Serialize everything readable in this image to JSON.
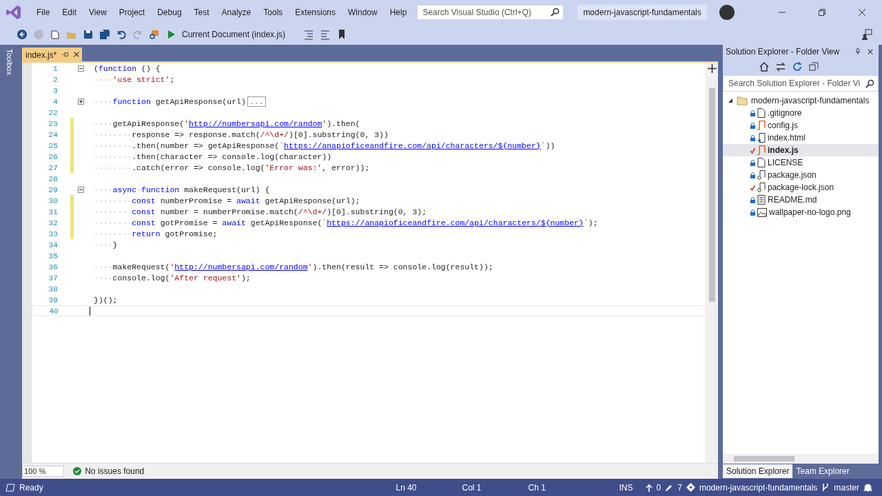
{
  "menu": [
    "File",
    "Edit",
    "View",
    "Project",
    "Debug",
    "Test",
    "Analyze",
    "Tools",
    "Extensions",
    "Window",
    "Help"
  ],
  "search": {
    "placeholder": "Search Visual Studio (Ctrl+Q)"
  },
  "solution_name": "modern-javascript-fundamentals",
  "toolbar": {
    "run_target": "Current Document (index.js)"
  },
  "toolbox": "Toolbox",
  "editor": {
    "tab": {
      "label": "index.js*",
      "selected": true
    },
    "lines": [
      {
        "number": "1",
        "modified": false,
        "expanded": true,
        "current": false,
        "segments": [
          {
            "kind": "plain",
            "text": "("
          },
          {
            "kind": "keyword",
            "text": "function"
          },
          {
            "kind": "plain",
            "text": " () {"
          }
        ]
      },
      {
        "number": "2",
        "modified": false,
        "current": false,
        "segments": [
          {
            "kind": "whitespace",
            "text": "····"
          },
          {
            "kind": "string",
            "text": "'use strict'"
          },
          {
            "kind": "plain",
            "text": ";"
          }
        ]
      },
      {
        "number": "3",
        "modified": false,
        "current": false
      },
      {
        "number": "4",
        "modified": false,
        "expanded": false,
        "current": false,
        "segments": [
          {
            "kind": "whitespace",
            "text": "····"
          },
          {
            "kind": "keyword",
            "text": "function"
          },
          {
            "kind": "plain",
            "text": " getApiResponse(url)"
          },
          {
            "kind": "collapsed",
            "text": "..."
          }
        ]
      },
      {
        "number": "22",
        "modified": false,
        "current": false
      },
      {
        "number": "23",
        "modified": true,
        "current": false,
        "segments": [
          {
            "kind": "whitespace",
            "text": "····"
          },
          {
            "kind": "plain",
            "text": "getApiResponse("
          },
          {
            "kind": "string",
            "text": "'"
          },
          {
            "kind": "link",
            "text": "http://numbersapi.com/random"
          },
          {
            "kind": "string",
            "text": "'"
          },
          {
            "kind": "plain",
            "text": ").then("
          }
        ]
      },
      {
        "number": "24",
        "modified": true,
        "current": false,
        "segments": [
          {
            "kind": "whitespace",
            "text": "········"
          },
          {
            "kind": "plain",
            "text": "response => response.match("
          },
          {
            "kind": "string",
            "text": "/^\\d+/"
          },
          {
            "kind": "plain",
            "text": ")[0].substring(0, 3))"
          }
        ]
      },
      {
        "number": "25",
        "modified": true,
        "current": false,
        "segments": [
          {
            "kind": "whitespace",
            "text": "········"
          },
          {
            "kind": "plain",
            "text": ".then(number => getApiResponse("
          },
          {
            "kind": "string",
            "text": "`"
          },
          {
            "kind": "link",
            "text": "https://anapioficeandfire.com/api/characters/${number}"
          },
          {
            "kind": "string",
            "text": "`"
          },
          {
            "kind": "plain",
            "text": "))"
          }
        ]
      },
      {
        "number": "26",
        "modified": true,
        "current": false,
        "segments": [
          {
            "kind": "whitespace",
            "text": "········"
          },
          {
            "kind": "plain",
            "text": ".then(character => console.log(character))"
          }
        ]
      },
      {
        "number": "27",
        "modified": true,
        "current": false,
        "segments": [
          {
            "kind": "whitespace",
            "text": "········"
          },
          {
            "kind": "plain",
            "text": ".catch(error => console.log("
          },
          {
            "kind": "string",
            "text": "'Error was:'"
          },
          {
            "kind": "plain",
            "text": ", error));"
          }
        ]
      },
      {
        "number": "28",
        "modified": false,
        "current": false
      },
      {
        "number": "29",
        "modified": false,
        "expanded": true,
        "current": false,
        "segments": [
          {
            "kind": "whitespace",
            "text": "····"
          },
          {
            "kind": "keyword",
            "text": "async"
          },
          {
            "kind": "whitespace",
            "text": "·"
          },
          {
            "kind": "keyword",
            "text": "function"
          },
          {
            "kind": "plain",
            "text": " makeRequest(url) {"
          }
        ]
      },
      {
        "number": "30",
        "modified": true,
        "current": false,
        "segments": [
          {
            "kind": "whitespace",
            "text": "········"
          },
          {
            "kind": "keyword",
            "text": "const"
          },
          {
            "kind": "plain",
            "text": " numberPromise = "
          },
          {
            "kind": "keyword",
            "text": "await"
          },
          {
            "kind": "plain",
            "text": " getApiResponse(url);"
          }
        ]
      },
      {
        "number": "31",
        "modified": true,
        "current": false,
        "segments": [
          {
            "kind": "whitespace",
            "text": "········"
          },
          {
            "kind": "keyword",
            "text": "const"
          },
          {
            "kind": "plain",
            "text": " number = numberPromise.match("
          },
          {
            "kind": "string",
            "text": "/^\\d+/"
          },
          {
            "kind": "plain",
            "text": ")[0].substring(0, 3);"
          }
        ]
      },
      {
        "number": "32",
        "modified": true,
        "current": false,
        "segments": [
          {
            "kind": "whitespace",
            "text": "········"
          },
          {
            "kind": "keyword",
            "text": "const"
          },
          {
            "kind": "plain",
            "text": " gotPromise = "
          },
          {
            "kind": "keyword",
            "text": "await"
          },
          {
            "kind": "plain",
            "text": " getApiResponse("
          },
          {
            "kind": "string",
            "text": "`"
          },
          {
            "kind": "link",
            "text": "https://anapioficeandfire.com/api/characters/${number}"
          },
          {
            "kind": "string",
            "text": "`"
          },
          {
            "kind": "plain",
            "text": ");"
          }
        ]
      },
      {
        "number": "33",
        "modified": true,
        "current": false,
        "segments": [
          {
            "kind": "whitespace",
            "text": "········"
          },
          {
            "kind": "keyword",
            "text": "return"
          },
          {
            "kind": "plain",
            "text": " gotPromise;"
          }
        ]
      },
      {
        "number": "34",
        "modified": false,
        "current": false,
        "segments": [
          {
            "kind": "whitespace",
            "text": "····"
          },
          {
            "kind": "plain",
            "text": "}"
          }
        ]
      },
      {
        "number": "35",
        "modified": false,
        "current": false
      },
      {
        "number": "36",
        "modified": false,
        "current": false,
        "segments": [
          {
            "kind": "whitespace",
            "text": "····"
          },
          {
            "kind": "plain",
            "text": "makeRequest("
          },
          {
            "kind": "string",
            "text": "'"
          },
          {
            "kind": "link",
            "text": "http://numbersapi.com/random"
          },
          {
            "kind": "string",
            "text": "'"
          },
          {
            "kind": "plain",
            "text": ").then(result => console.log(result));"
          }
        ]
      },
      {
        "number": "37",
        "modified": false,
        "current": false,
        "segments": [
          {
            "kind": "whitespace",
            "text": "····"
          },
          {
            "kind": "plain",
            "text": "console.log("
          },
          {
            "kind": "string",
            "text": "'After request'"
          },
          {
            "kind": "plain",
            "text": ");"
          }
        ]
      },
      {
        "number": "38",
        "modified": false,
        "current": false
      },
      {
        "number": "39",
        "modified": false,
        "current": false,
        "segments": [
          {
            "kind": "plain",
            "text": "})();"
          }
        ]
      },
      {
        "number": "40",
        "modified": false,
        "current": true
      }
    ],
    "zoom": "100 %",
    "issues": "No issues found"
  },
  "solution_explorer": {
    "title": "Solution Explorer - Folder View",
    "search": {
      "placeholder": "Search Solution Explorer - Folder Vi"
    },
    "root": {
      "label": "modern-javascript-fundamentals",
      "expanded": true,
      "children": [
        {
          "label": ".gitignore",
          "modified": false,
          "kind": "file",
          "selected": false
        },
        {
          "label": "config.js",
          "modified": false,
          "kind": "script",
          "selected": false
        },
        {
          "label": "index.html",
          "modified": false,
          "kind": "html",
          "selected": false
        },
        {
          "label": "index.js",
          "modified": true,
          "kind": "script",
          "selected": true
        },
        {
          "label": "LICENSE",
          "modified": false,
          "kind": "file",
          "selected": false
        },
        {
          "label": "package.json",
          "modified": false,
          "kind": "json",
          "selected": false
        },
        {
          "label": "package-lock.json",
          "modified": true,
          "kind": "json",
          "selected": false
        },
        {
          "label": "README.md",
          "modified": false,
          "kind": "text",
          "selected": false
        },
        {
          "label": "wallpaper-no-logo.png",
          "modified": false,
          "kind": "image",
          "selected": false
        }
      ]
    },
    "tabs": [
      {
        "label": "Solution Explorer",
        "selected": true
      },
      {
        "label": "Team Explorer",
        "selected": false
      }
    ]
  },
  "status_bar": {
    "state": "Ready",
    "ln": "Ln 40",
    "col": "Col 1",
    "ch": "Ch 1",
    "mode": "INS",
    "pushes": "0",
    "edits": "7",
    "repo": "modern-javascript-fundamentals",
    "branch": "master"
  }
}
